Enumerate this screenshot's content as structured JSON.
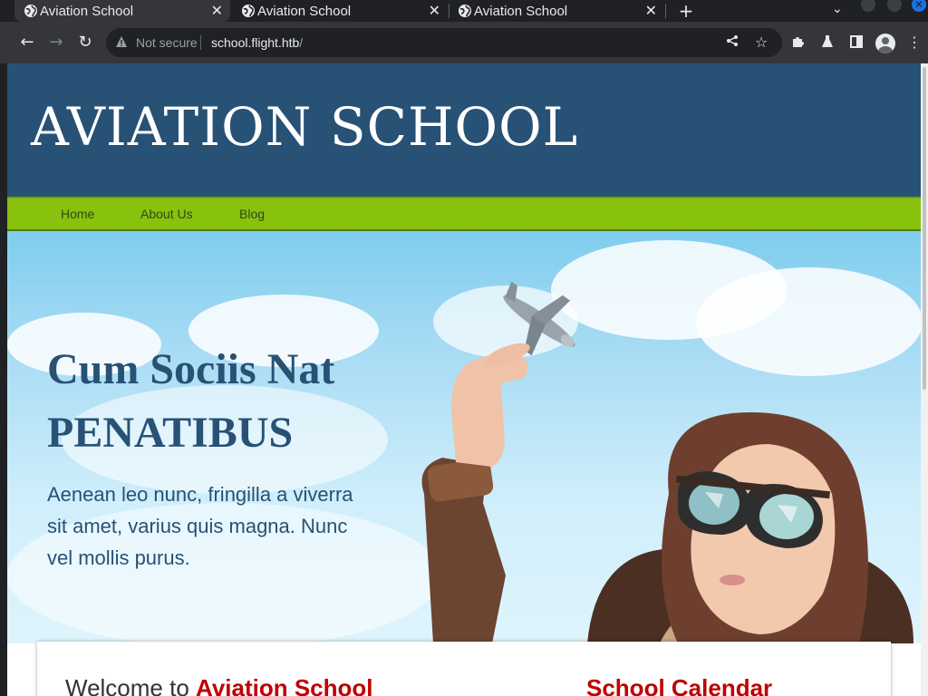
{
  "browser": {
    "tabs": [
      {
        "title": "Aviation School",
        "active": true
      },
      {
        "title": "Aviation School",
        "active": false
      },
      {
        "title": "Aviation School",
        "active": false
      }
    ],
    "new_tab_label": "+",
    "security_label": "Not secure",
    "url_host": "school.flight.htb",
    "url_path": "/"
  },
  "site": {
    "title": "AVIATION SCHOOL",
    "nav": [
      "Home",
      "About Us",
      "Blog"
    ],
    "hero": {
      "heading_line1": "Cum Sociis Nat",
      "heading_line2": "PENATIBUS",
      "text": "Aenean leo nunc, fringilla a viverra sit amet, varius quis magna. Nunc vel mollis purus."
    },
    "welcome_prefix": "Welcome to ",
    "welcome_accent": "Aviation School",
    "calendar_title": "School Calendar"
  },
  "colors": {
    "header_bg": "#275175",
    "nav_bg": "#88c10e",
    "accent_red": "#c00000",
    "hero_text": "#275175"
  }
}
